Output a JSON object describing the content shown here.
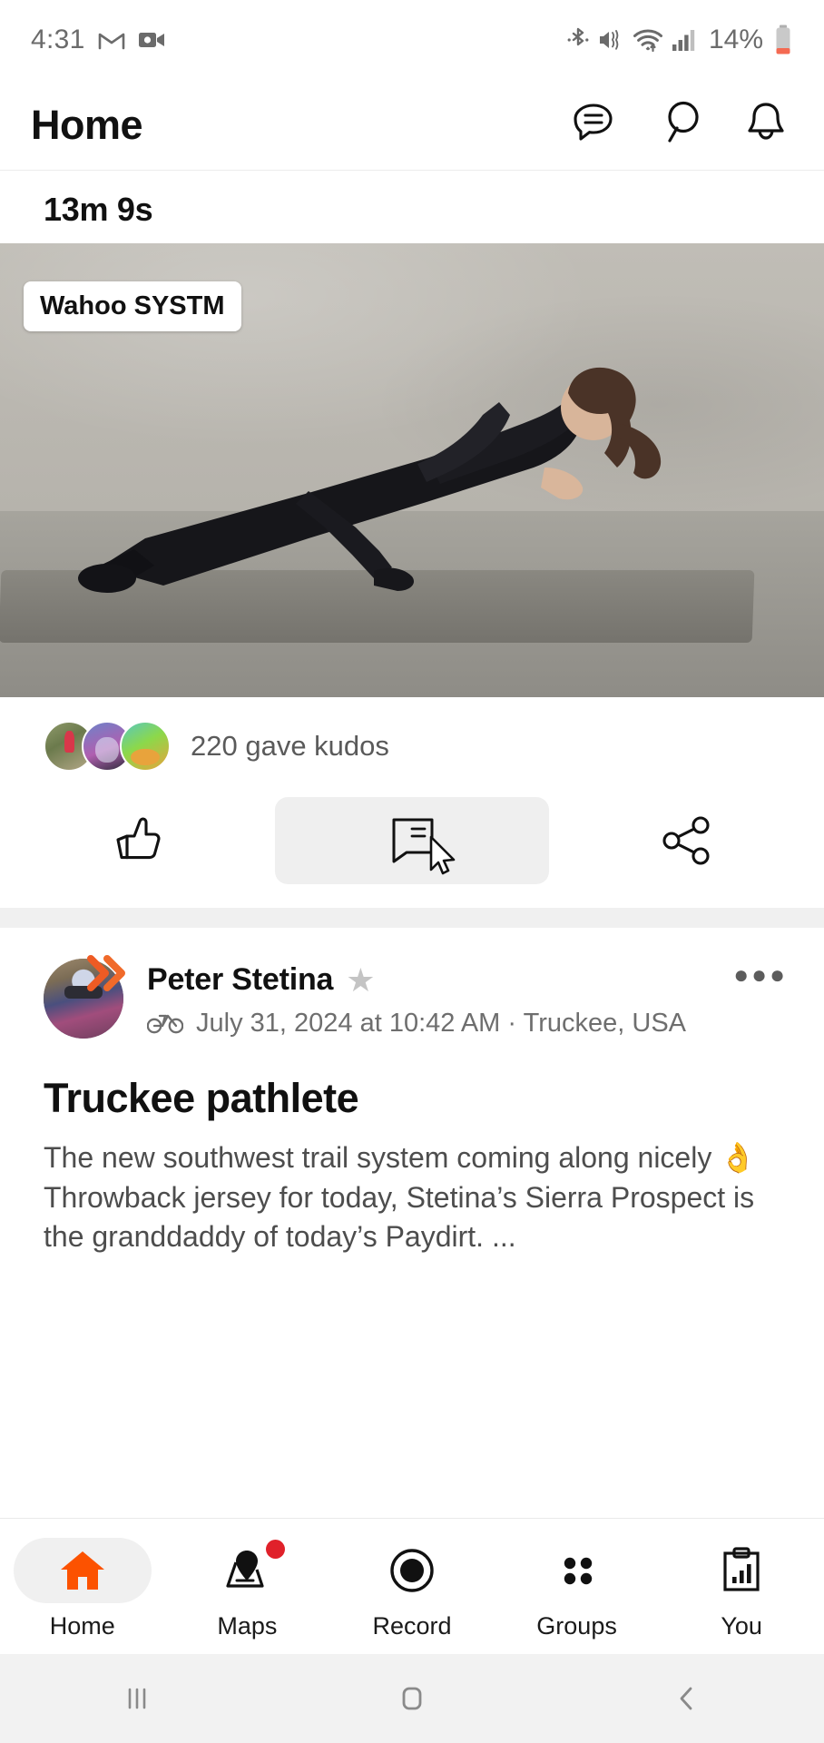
{
  "status_bar": {
    "time": "4:31",
    "battery_percent": "14%",
    "icons": [
      "gmail-icon",
      "video-camera-icon",
      "bluetooth-icon",
      "mute-vibrate-icon",
      "wifi-icon",
      "cellular-signal-icon",
      "battery-icon"
    ]
  },
  "header": {
    "title": "Home",
    "actions": [
      "chat-icon",
      "search-icon",
      "notifications-icon"
    ]
  },
  "feed": {
    "workout_card": {
      "duration": "13m 9s",
      "photo_badge": "Wahoo SYSTM",
      "kudos_text": "220 gave kudos",
      "kudos_count": "220",
      "actions": {
        "kudos_label": "kudos-thumbs-up",
        "comment_label": "comment",
        "share_label": "share"
      }
    },
    "activity_card": {
      "author_name": "Peter Stetina",
      "author_badge": "star-icon",
      "sport_icon": "bicycle-icon",
      "meta": "July 31, 2024 at 10:42 AM · Truckee, USA",
      "date": "July 31, 2024",
      "time": "10:42 AM",
      "location": "Truckee, USA",
      "title": "Truckee pathlete",
      "description": "The new southwest trail system coming along nicely 👌 Throwback jersey for today, Stetina’s Sierra Prospect is the granddaddy of today’s Paydirt. ...",
      "more_menu": "⬤⬤⬤"
    }
  },
  "bottom_nav": {
    "items": [
      {
        "label": "Home",
        "icon": "home-icon",
        "active": true,
        "badge": false
      },
      {
        "label": "Maps",
        "icon": "maps-pin-icon",
        "active": false,
        "badge": true
      },
      {
        "label": "Record",
        "icon": "record-icon",
        "active": false,
        "badge": false
      },
      {
        "label": "Groups",
        "icon": "groups-icon",
        "active": false,
        "badge": false
      },
      {
        "label": "You",
        "icon": "profile-stats-icon",
        "active": false,
        "badge": false
      }
    ]
  },
  "system_nav": {
    "recents": "recents-icon",
    "home": "home-square-icon",
    "back": "back-chevron-icon"
  },
  "colors": {
    "accent_orange": "#fc5200",
    "badge_red": "#e0212a",
    "text_primary": "#111111",
    "text_secondary": "#5a5a5a"
  }
}
